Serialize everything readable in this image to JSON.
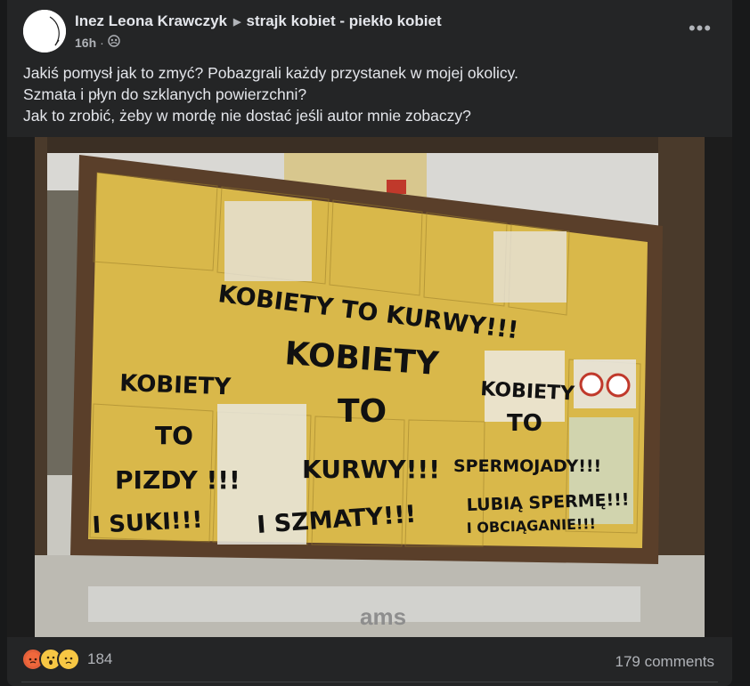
{
  "post": {
    "author": "Inez Leona Krawczyk",
    "group": "strajk kobiet - piekło kobiet",
    "time": "16h",
    "separator": "·",
    "text_lines": [
      "Jakiś pomysł jak to zmyć? Pobazgrali każdy przystanek w mojej okolicy.",
      "Szmata i płyn do szklanych powierzchni?",
      "Jak to zrobić, żeby w mordę nie dostać jeśli autor mnie zobaczy?"
    ]
  },
  "icons": {
    "privacy": "friends-icon",
    "more": "more-options-icon",
    "group_arrow": "caret-right-icon",
    "reactions": [
      "angry-reaction-icon",
      "wow-reaction-icon",
      "sad-reaction-icon"
    ]
  },
  "photo": {
    "sign_lines": [
      "KOBIETY TO KURWY!!!",
      "KOBIETY",
      "KOBIETY",
      "KOBIETY",
      "TO",
      "TO",
      "TO",
      "PIZDY !!!",
      "KURWY!!!",
      "SPERMOJADY!!!",
      "I SUKI!!!",
      "I SZMATY!!!",
      "LUBIĄ SPERMĘ!!!",
      "I OBCIĄGANIE!!!"
    ],
    "brand": "ams"
  },
  "footer": {
    "reaction_count": "184",
    "comments": "179 comments"
  },
  "colors": {
    "background": "#18191a",
    "card": "#242526",
    "text_primary": "#e4e6eb",
    "text_secondary": "#b0b3b8",
    "poster_yellow": "#e8c24a"
  }
}
